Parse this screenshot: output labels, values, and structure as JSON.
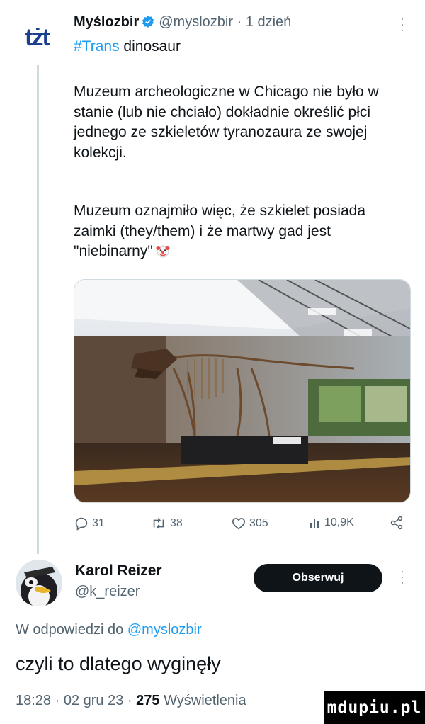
{
  "tweet": {
    "author_logo_text": "tżt",
    "author_name": "Myślozbir",
    "handle": "@myslozbir",
    "separator": "·",
    "time": "1 dzień",
    "hashtag": "#Trans",
    "hashtag_suffix": " dinosaur",
    "paragraph1": "Muzeum archeologiczne w Chicago nie było w stanie (lub nie chciało) dokładnie określić płci jednego ze szkieletów tyranozaura ze swojej kolekcji.",
    "paragraph2": "Muzeum oznajmiło więc, że szkielet posiada zaimki (they/them) i że martwy gad jest \"niebinarny\"",
    "emoji": "clown-face",
    "actions": {
      "replies": "31",
      "retweets": "38",
      "likes": "305",
      "views": "10,9K"
    },
    "colors": {
      "accent": "#1d9bf0",
      "text": "#0f1419",
      "muted": "#536471"
    }
  },
  "reply": {
    "name": "Karol Reizer",
    "handle": "@k_reizer",
    "follow_label": "Obserwuj",
    "replying_to_prefix": "W odpowiedzi do ",
    "replying_to": "@myslozbir",
    "text": "czyli to dlatego wyginęły",
    "time": "18:28",
    "date": "02 gru 23",
    "views_count": "275",
    "views_label": "Wyświetlenia"
  },
  "watermark": "mdupiu.pl"
}
